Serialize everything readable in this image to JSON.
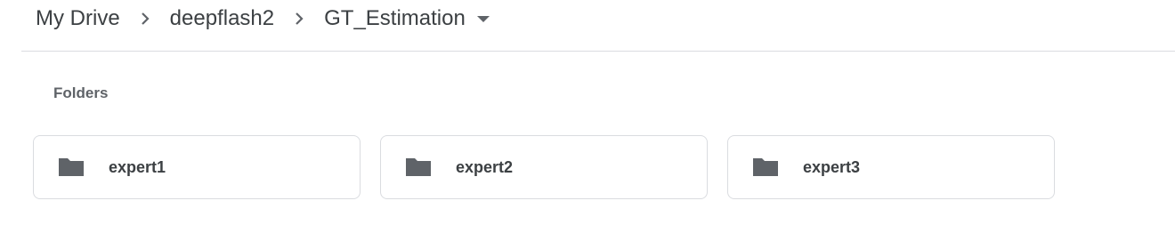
{
  "breadcrumb": {
    "items": [
      {
        "label": "My Drive"
      },
      {
        "label": "deepflash2"
      },
      {
        "label": "GT_Estimation"
      }
    ]
  },
  "sections": {
    "folders_title": "Folders"
  },
  "folders": [
    {
      "name": "expert1",
      "icon": "folder-icon"
    },
    {
      "name": "expert2",
      "icon": "folder-icon"
    },
    {
      "name": "expert3",
      "icon": "folder-icon"
    }
  ],
  "colors": {
    "text": "#3c4043",
    "muted": "#5f6368",
    "border": "#dadce0",
    "icon": "#5f6368"
  }
}
